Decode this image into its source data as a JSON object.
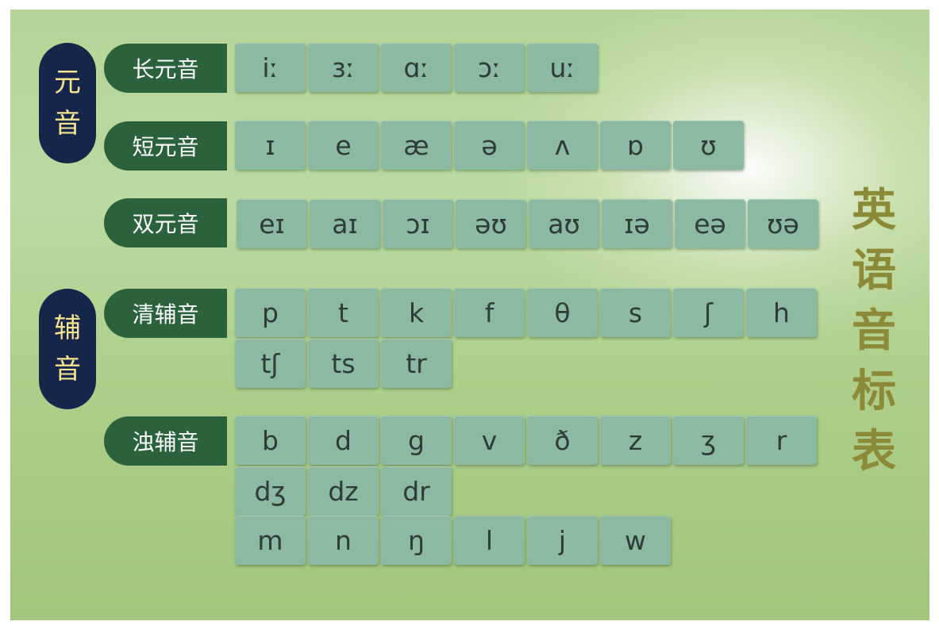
{
  "title_chars": [
    "英",
    "语",
    "音",
    "标",
    "表"
  ],
  "groups": {
    "vowel": [
      "元",
      "音"
    ],
    "consonant": [
      "辅",
      "音"
    ]
  },
  "rows": {
    "long": {
      "label": "长元音",
      "symbols": [
        "iː",
        "ɜː",
        "ɑː",
        "ɔː",
        "uː"
      ]
    },
    "short": {
      "label": "短元音",
      "symbols": [
        "ɪ",
        "e",
        "æ",
        "ə",
        "ʌ",
        "ɒ",
        "ʊ"
      ]
    },
    "diph": {
      "label": "双元音",
      "symbols": [
        "eɪ",
        "aɪ",
        "ɔɪ",
        "əʊ",
        "aʊ",
        "ɪə",
        "eə",
        "ʊə"
      ]
    },
    "voiceless": {
      "label": "清辅音",
      "symbols": [
        "p",
        "t",
        "k",
        "f",
        "θ",
        "s",
        "ʃ",
        "h",
        "tʃ",
        "ts",
        "tr"
      ]
    },
    "voiced": {
      "label": "浊辅音",
      "symbols": [
        "b",
        "d",
        "g",
        "v",
        "ð",
        "z",
        "ʒ",
        "r",
        "dʒ",
        "dz",
        "dr",
        "m",
        "n",
        "ŋ",
        "l",
        "j",
        "w"
      ]
    }
  },
  "colors": {
    "background": "#aecf8b",
    "group_pill": "#15264a",
    "group_text": "#f4e38f",
    "row_label": "#2a623c",
    "tile": "#8cb9a1",
    "title": "#8c8a36"
  }
}
